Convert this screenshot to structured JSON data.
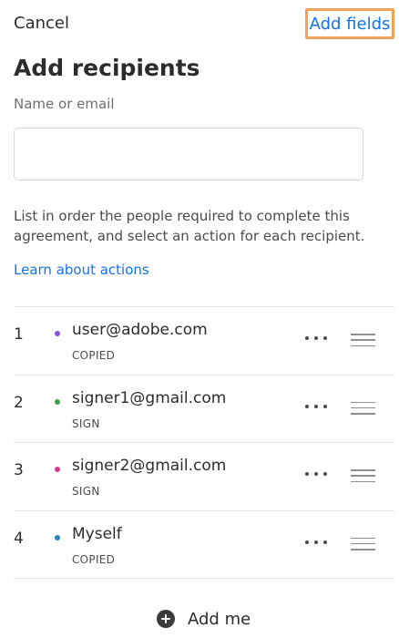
{
  "header": {
    "cancel_label": "Cancel",
    "add_fields_label": "Add fields",
    "title": "Add recipients"
  },
  "form": {
    "name_label": "Name or email",
    "name_value": "",
    "name_placeholder": ""
  },
  "instructions": "List in order the people required to complete this agreement, and select an action for each recipient.",
  "learn_link": "Learn about actions",
  "recipients": [
    {
      "number": "1",
      "email": "user@adobe.com",
      "role": "COPIED",
      "dot_color": "#8b4fe8"
    },
    {
      "number": "2",
      "email": "signer1@gmail.com",
      "role": "SIGN",
      "dot_color": "#3e9f4c"
    },
    {
      "number": "3",
      "email": "signer2@gmail.com",
      "role": "SIGN",
      "dot_color": "#d83790"
    },
    {
      "number": "4",
      "email": "Myself",
      "role": "COPIED",
      "dot_color": "#2680c2"
    }
  ],
  "icons": {
    "more": "more-horizontal-icon",
    "drag": "drag-handle-icon",
    "add": "add-circle-icon"
  },
  "add_me_label": "Add me",
  "colors": {
    "accent": "#1473e6",
    "highlight": "#f0a35a"
  }
}
